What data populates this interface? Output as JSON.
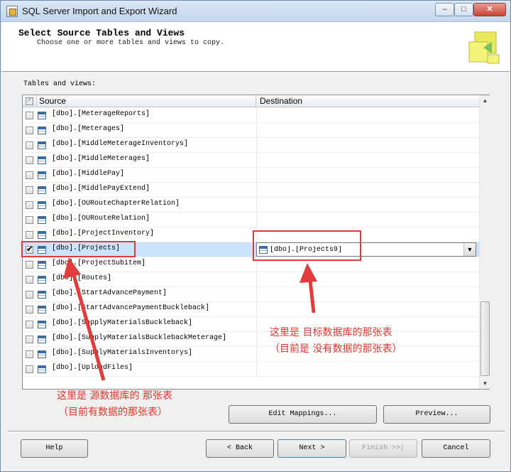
{
  "window": {
    "title": "SQL Server Import and Export Wizard",
    "minimize": "0",
    "maximize": "□",
    "close": "✕"
  },
  "header": {
    "title": "Select Source Tables and Views",
    "subtitle": "Choose one or more tables and views to copy."
  },
  "tables_label": "Tables and views:",
  "grid": {
    "columns": {
      "source": "Source",
      "destination": "Destination"
    },
    "rows": [
      {
        "source": "[dbo].[MeterageReports]",
        "checked": false
      },
      {
        "source": "[dbo].[Meterages]",
        "checked": false
      },
      {
        "source": "[dbo].[MiddleMeterageInventorys]",
        "checked": false
      },
      {
        "source": "[dbo].[MiddleMeterages]",
        "checked": false
      },
      {
        "source": "[dbo].[MiddlePay]",
        "checked": false
      },
      {
        "source": "[dbo].[MiddlePayExtend]",
        "checked": false
      },
      {
        "source": "[dbo].[OURouteChapterRelation]",
        "checked": false
      },
      {
        "source": "[dbo].[OURouteRelation]",
        "checked": false
      },
      {
        "source": "[dbo].[ProjectInventory]",
        "checked": false
      },
      {
        "source": "[dbo].[Projects]",
        "checked": true,
        "destination": "[dbo].[Projects9]"
      },
      {
        "source": "[dbo].[ProjectSubitem]",
        "checked": false
      },
      {
        "source": "[dbo].[Routes]",
        "checked": false
      },
      {
        "source": "[dbo].[StartAdvancePayment]",
        "checked": false
      },
      {
        "source": "[dbo].[StartAdvancePaymentBuckleback]",
        "checked": false
      },
      {
        "source": "[dbo].[SupplyMaterialsBuckleback]",
        "checked": false
      },
      {
        "source": "[dbo].[SupplyMaterialsBucklebackMeterage]",
        "checked": false
      },
      {
        "source": "[dbo].[SupplyMaterialsInventorys]",
        "checked": false
      },
      {
        "source": "[dbo].[UploadFiles]",
        "checked": false
      }
    ]
  },
  "buttons": {
    "edit_mappings": "Edit Mappings...",
    "preview": "Preview...",
    "help": "Help",
    "back": "< Back",
    "next": "Next >",
    "finish": "Finish >>|",
    "cancel": "Cancel"
  },
  "annotations": {
    "destination_line1": "这里是 目标数据库的那张表",
    "destination_line2": "（目前是 没有数据的那张表）",
    "source_line1": "这里是 源数据库的 那张表",
    "source_line2": "（目前有数据的那张表）",
    "color": "#e3342c"
  },
  "colors": {
    "selected_row": "#cce4fb",
    "annotation_red": "#e23b3b"
  }
}
